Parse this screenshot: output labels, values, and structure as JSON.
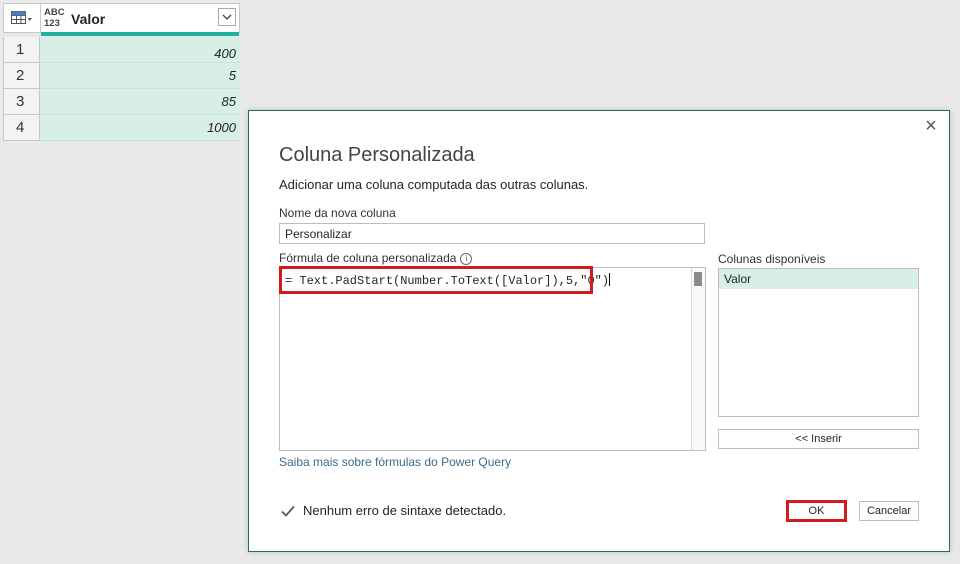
{
  "grid": {
    "column_type_icon_text": "ABC 123",
    "column_name": "Valor",
    "rows": [
      {
        "num": "1",
        "value": "400"
      },
      {
        "num": "2",
        "value": "5"
      },
      {
        "num": "3",
        "value": "85"
      },
      {
        "num": "4",
        "value": "1000"
      }
    ]
  },
  "dialog": {
    "title": "Coluna Personalizada",
    "description": "Adicionar uma coluna computada das outras colunas.",
    "name_label": "Nome da nova coluna",
    "name_value": "Personalizar",
    "formula_label": "Fórmula de coluna personalizada",
    "info_icon_glyph": "i",
    "formula": "= Text.PadStart(Number.ToText([Valor]),5,\"0\")",
    "available_label": "Colunas disponíveis",
    "available_columns": [
      "Valor"
    ],
    "insert_label": "<< Inserir",
    "learn_more_link": "Saiba mais sobre fórmulas do Power Query",
    "status_text": "Nenhum erro de sintaxe detectado.",
    "ok_label": "OK",
    "cancel_label": "Cancelar",
    "close_glyph": "×"
  },
  "colors": {
    "accent_teal": "#1bb39e",
    "selected_cell": "#d7efe4",
    "highlight_red": "#d01c1c",
    "dialog_border": "#217346",
    "link": "#3a6b8c"
  },
  "icons": [
    "table-icon",
    "type-any-icon",
    "filter-dropdown-icon",
    "close-icon",
    "info-icon",
    "check-icon"
  ]
}
